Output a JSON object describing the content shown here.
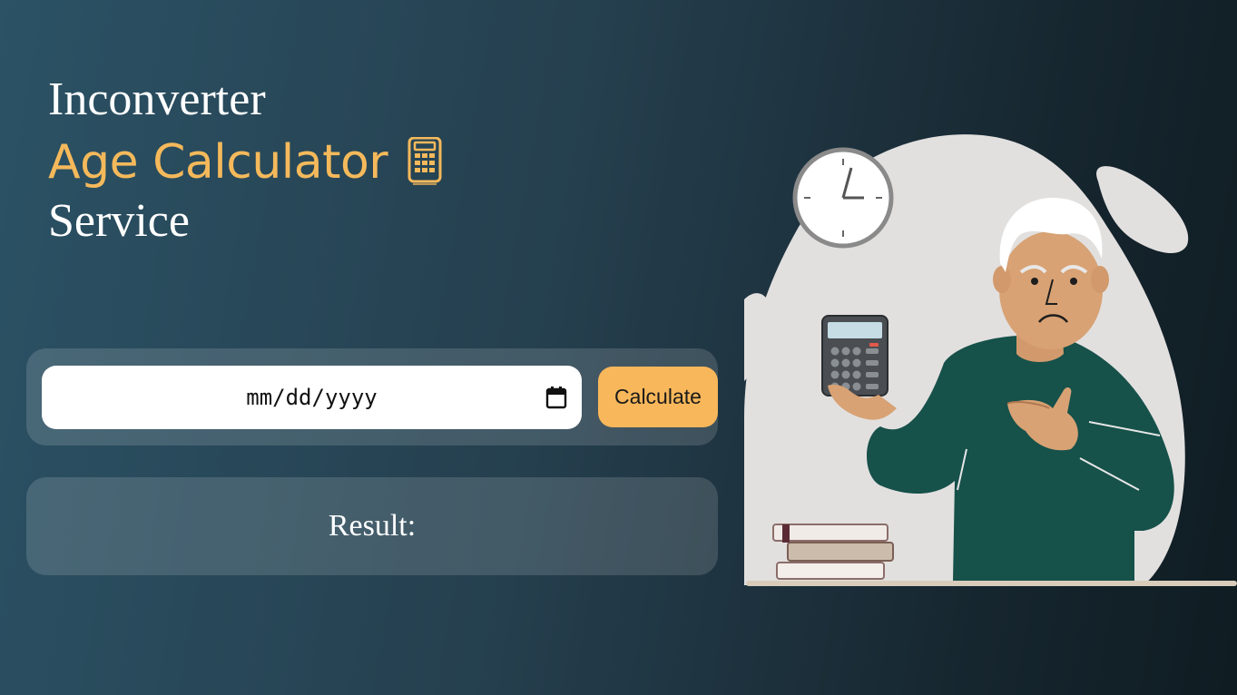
{
  "header": {
    "brand": "Inconverter",
    "title": "Age Calculator",
    "subtitle": "Service"
  },
  "form": {
    "date_placeholder": "mm/dd/yyyy",
    "calculate_label": "Calculate"
  },
  "result": {
    "label": "Result:"
  },
  "icons": {
    "title_icon": "calculator-icon",
    "date_icon": "calendar-icon"
  },
  "colors": {
    "accent": "#f5b95b",
    "button": "#f8b75a",
    "shirt": "#16514a"
  }
}
